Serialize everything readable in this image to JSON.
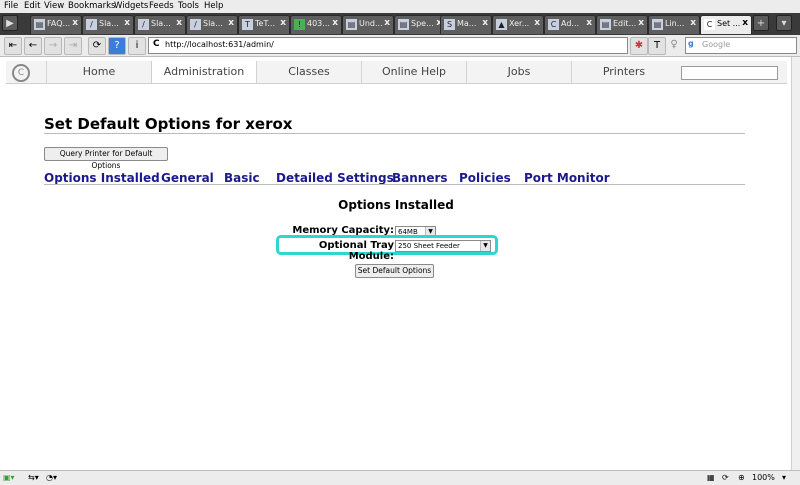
{
  "menubar": [
    "File",
    "Edit",
    "View",
    "Bookmarks",
    "Widgets",
    "Feeds",
    "Tools",
    "Help"
  ],
  "tabs": [
    {
      "label": "FAQ..."
    },
    {
      "label": "Sla..."
    },
    {
      "label": "Sla..."
    },
    {
      "label": "Sla..."
    },
    {
      "label": "TeT..."
    },
    {
      "label": "403..."
    },
    {
      "label": "Und..."
    },
    {
      "label": "Spe..."
    },
    {
      "label": "Ma..."
    },
    {
      "label": "Xer..."
    },
    {
      "label": "Ad..."
    },
    {
      "label": "Edit..."
    },
    {
      "label": "Lin..."
    },
    {
      "label": "Set ..."
    }
  ],
  "address": {
    "url": "http://localhost:631/admin/",
    "search_placeholder": "Google"
  },
  "cups_nav": {
    "tabs": [
      "Home",
      "Administration",
      "Classes",
      "Online Help",
      "Jobs",
      "Printers"
    ],
    "active": "Administration"
  },
  "page": {
    "title": "Set Default Options for xerox",
    "query_button": "Query Printer for Default Options",
    "sections": [
      "Options Installed",
      "General",
      "Basic",
      "Detailed Settings",
      "Banners",
      "Policies",
      "Port Monitor"
    ],
    "heading": "Options Installed",
    "memory_label": "Memory Capacity:",
    "memory_value": "64MB",
    "tray_label": "Optional Tray Module:",
    "tray_value": "250 Sheet Feeder",
    "submit_button": "Set Default Options"
  },
  "statusbar": {
    "zoom": "100%"
  }
}
